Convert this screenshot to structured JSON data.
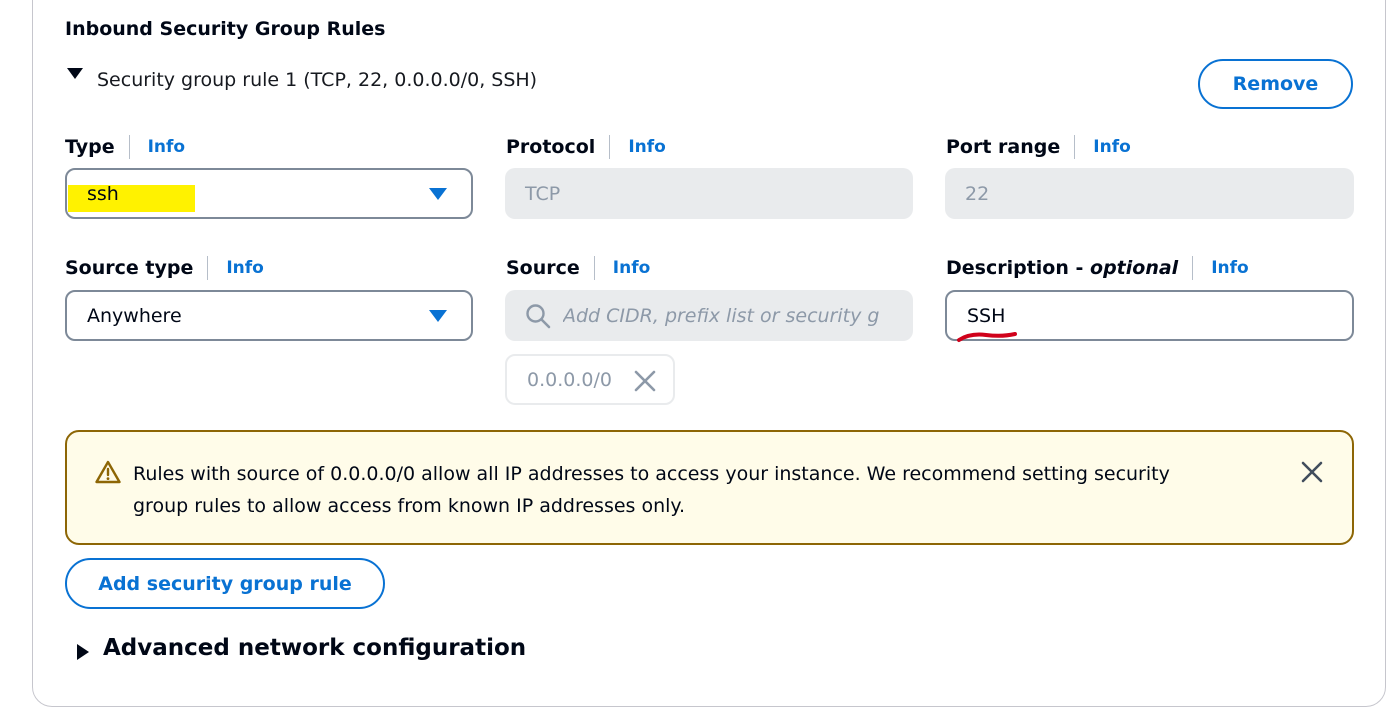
{
  "section": {
    "title": "Inbound Security Group Rules"
  },
  "rule": {
    "title": "Security group rule 1 (TCP, 22, 0.0.0.0/0, SSH)",
    "remove_label": "Remove",
    "type": {
      "label": "Type",
      "info": "Info",
      "value": "ssh"
    },
    "protocol": {
      "label": "Protocol",
      "info": "Info",
      "value": "TCP"
    },
    "port_range": {
      "label": "Port range",
      "info": "Info",
      "value": "22"
    },
    "source_type": {
      "label": "Source type",
      "info": "Info",
      "value": "Anywhere"
    },
    "source": {
      "label": "Source",
      "info": "Info",
      "placeholder": "Add CIDR, prefix list or security g",
      "token": "0.0.0.0/0"
    },
    "description": {
      "label": "Description - ",
      "label_suffix": "optional",
      "info": "Info",
      "value": "SSH"
    }
  },
  "alert": {
    "line1": "Rules with source of 0.0.0.0/0 allow all IP addresses to access your instance. We recommend setting security",
    "line2": "group rules to allow access from known IP addresses only."
  },
  "add_rule_label": "Add security group rule",
  "advanced": {
    "label": "Advanced network configuration"
  },
  "colors": {
    "accent": "#0972d3",
    "warning_border": "#8d6605",
    "warning_bg": "#fffce9",
    "highlight": "#fff200",
    "annotation": "#d0021b"
  },
  "icons": [
    "caret-down-icon",
    "caret-right-icon",
    "dropdown-caret-icon",
    "search-icon",
    "close-icon",
    "warning-icon"
  ]
}
